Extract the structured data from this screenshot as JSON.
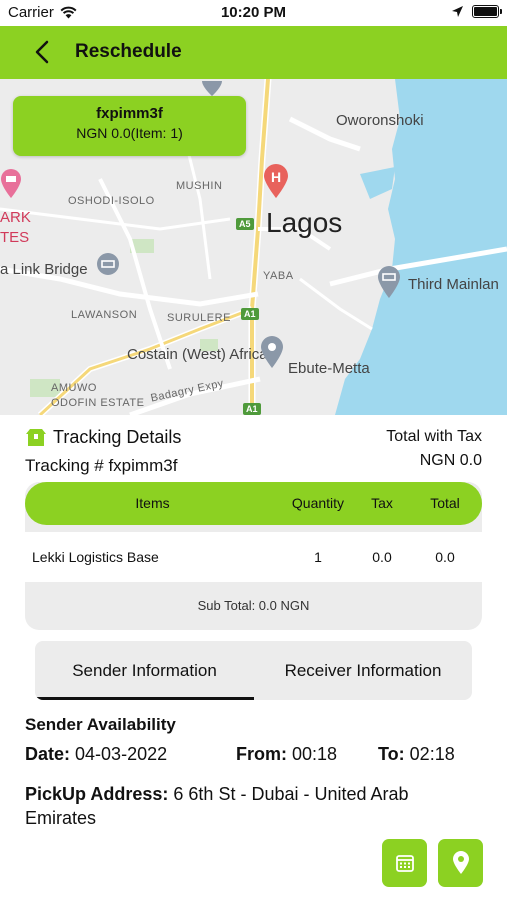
{
  "status_bar": {
    "carrier": "Carrier",
    "time": "10:20 PM"
  },
  "nav": {
    "title": "Reschedule",
    "back_icon": "chevron-left-icon"
  },
  "map": {
    "callout": {
      "id": "fxpimm3f",
      "summary": "NGN 0.0(Item: 1)"
    },
    "labels": {
      "oworonshoki": "Oworonshoki",
      "mushin": "MUSHIN",
      "oshodi": "OSHODI-ISOLO",
      "lagos": "Lagos",
      "ark": "ARK",
      "tes": "TES",
      "link_bridge": "a Link Bridge",
      "yaba": "YABA",
      "third_mainland": "Third Mainlan",
      "lawanson": "LAWANSON",
      "surulere": "SURULERE",
      "costain": "Costain (West) Africa",
      "ebute_metta": "Ebute-Metta",
      "amuwo": "AMUWO",
      "odofin": "ODOFIN ESTATE",
      "badagry": "Badagry Expy",
      "a5": "A5",
      "a1": "A1",
      "a1b": "A1"
    }
  },
  "tracking": {
    "title": "Tracking Details",
    "number_label": "Tracking # fxpimm3f",
    "total_label": "Total with Tax",
    "total_value": "NGN 0.0"
  },
  "table": {
    "headers": {
      "items": "Items",
      "quantity": "Quantity",
      "tax": "Tax",
      "total": "Total"
    },
    "rows": [
      {
        "item": "Lekki Logistics Base",
        "quantity": "1",
        "tax": "0.0",
        "total": "0.0"
      }
    ],
    "subtotal": "Sub Total: 0.0 NGN"
  },
  "tabs": {
    "sender": "Sender Information",
    "receiver": "Receiver Information",
    "active": "sender"
  },
  "sender": {
    "availability_heading": "Sender Availability",
    "date_label": "Date:",
    "date_value": "04-03-2022",
    "from_label": "From:",
    "from_value": "00:18",
    "to_label": "To:",
    "to_value": "02:18",
    "address_label": "PickUp Address:",
    "address_value": "6 6th St - Dubai - United Arab Emirates"
  },
  "actions": {
    "calendar_icon": "calendar-icon",
    "location_icon": "location-pin-icon"
  },
  "colors": {
    "accent": "#8cd122",
    "table_bg": "#ececec"
  }
}
